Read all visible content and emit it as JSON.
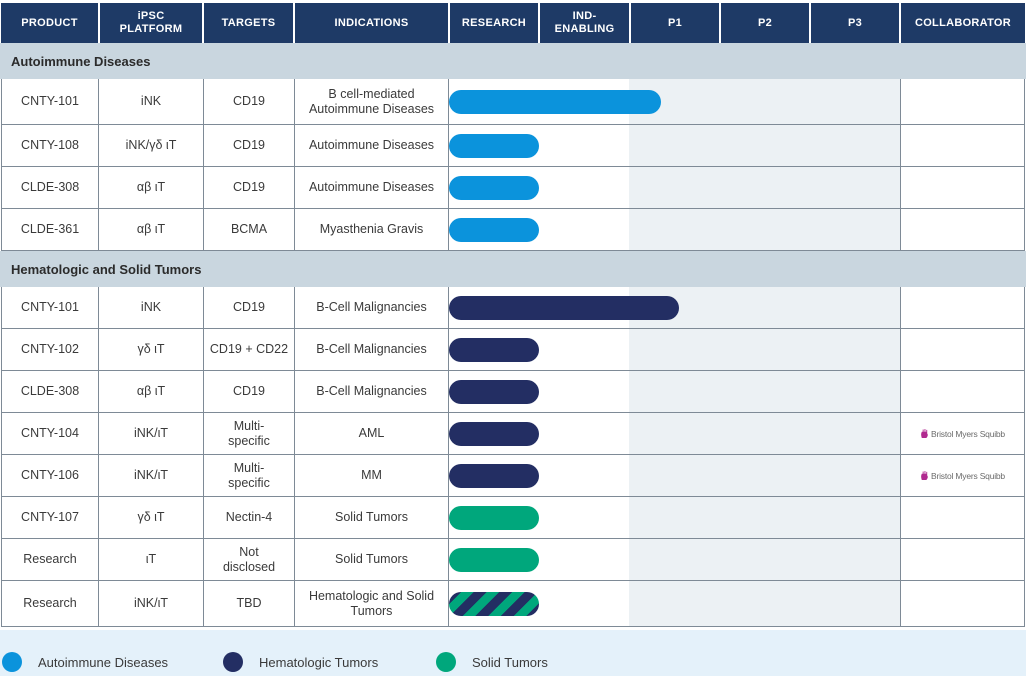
{
  "headers": {
    "product": "PRODUCT",
    "platform": "iPSC\nPLATFORM",
    "targets": "TARGETS",
    "indications": "INDICATIONS",
    "research": "RESEARCH",
    "ind": "IND-\nENABLING",
    "p1": "P1",
    "p2": "P2",
    "p3": "P3",
    "collaborator": "COLLABORATOR"
  },
  "colors": {
    "header_bg": "#1e3a66",
    "autoimmune": "#0b93dc",
    "hematologic": "#232e63",
    "solid": "#00a77c"
  },
  "sections": [
    {
      "title": "Autoimmune Diseases",
      "rows": [
        {
          "product": "CNTY-101",
          "platform": "iNK",
          "targets": "CD19",
          "indication": "B cell-mediated\nAutoimmune Diseases",
          "category": "autoimmune",
          "progress": 0.47,
          "collaborator": ""
        },
        {
          "product": "CNTY-108",
          "platform": "iNK/γδ ιT",
          "targets": "CD19",
          "indication": "Autoimmune Diseases",
          "category": "autoimmune",
          "progress": 0.2,
          "collaborator": ""
        },
        {
          "product": "CLDE-308",
          "platform": "αβ ιT",
          "targets": "CD19",
          "indication": "Autoimmune Diseases",
          "category": "autoimmune",
          "progress": 0.2,
          "collaborator": ""
        },
        {
          "product": "CLDE-361",
          "platform": "αβ ιT",
          "targets": "BCMA",
          "indication": "Myasthenia Gravis",
          "category": "autoimmune",
          "progress": 0.2,
          "collaborator": ""
        }
      ]
    },
    {
      "title": "Hematologic and Solid Tumors",
      "rows": [
        {
          "product": "CNTY-101",
          "platform": "iNK",
          "targets": "CD19",
          "indication": "B-Cell Malignancies",
          "category": "hematologic",
          "progress": 0.51,
          "collaborator": ""
        },
        {
          "product": "CNTY-102",
          "platform": "γδ ιT",
          "targets": "CD19 + CD22",
          "indication": "B-Cell Malignancies",
          "category": "hematologic",
          "progress": 0.2,
          "collaborator": ""
        },
        {
          "product": "CLDE-308",
          "platform": "αβ ιT",
          "targets": "CD19",
          "indication": "B-Cell Malignancies",
          "category": "hematologic",
          "progress": 0.2,
          "collaborator": ""
        },
        {
          "product": "CNTY-104",
          "platform": "iNK/ιT",
          "targets": "Multi-\nspecific",
          "indication": "AML",
          "category": "hematologic",
          "progress": 0.2,
          "collaborator": "Bristol Myers Squibb"
        },
        {
          "product": "CNTY-106",
          "platform": "iNK/ιT",
          "targets": "Multi-\nspecific",
          "indication": "MM",
          "category": "hematologic",
          "progress": 0.2,
          "collaborator": "Bristol Myers Squibb"
        },
        {
          "product": "CNTY-107",
          "platform": "γδ ιT",
          "targets": "Nectin-4",
          "indication": "Solid Tumors",
          "category": "solid",
          "progress": 0.2,
          "collaborator": ""
        },
        {
          "product": "Research",
          "platform": "ιT",
          "targets": "Not\ndisclosed",
          "indication": "Solid Tumors",
          "category": "solid",
          "progress": 0.2,
          "collaborator": ""
        },
        {
          "product": "Research",
          "platform": "iNK/ιT",
          "targets": "TBD",
          "indication": "Hematologic and Solid\nTumors",
          "category": "mixed",
          "progress": 0.2,
          "collaborator": ""
        }
      ]
    }
  ],
  "legend": [
    {
      "label": "Autoimmune Diseases",
      "category": "autoimmune"
    },
    {
      "label": "Hematologic Tumors",
      "category": "hematologic"
    },
    {
      "label": "Solid Tumors",
      "category": "solid"
    }
  ]
}
